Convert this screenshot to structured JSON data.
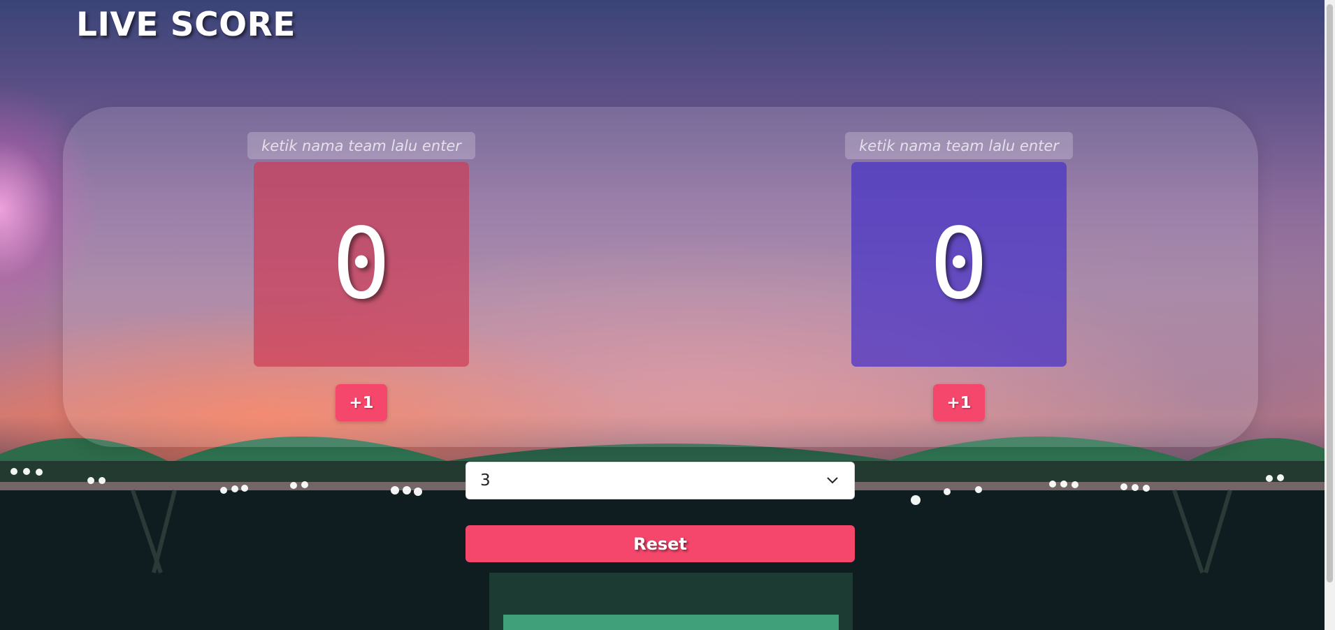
{
  "header": {
    "title": "LIVE SCORE"
  },
  "teams": [
    {
      "side": "left",
      "name_value": "",
      "name_placeholder": "ketik nama team lalu enter",
      "score": "0",
      "add_label": "+1",
      "color": "#cd3c55"
    },
    {
      "side": "right",
      "name_value": "",
      "name_placeholder": "ketik nama team lalu enter",
      "score": "0",
      "add_label": "+1",
      "color": "#4632c8"
    }
  ],
  "controls": {
    "target_select_value": "3",
    "reset_label": "Reset"
  },
  "colors": {
    "accent": "#f5466b"
  },
  "icons": {
    "select": "chevron-down-icon"
  }
}
